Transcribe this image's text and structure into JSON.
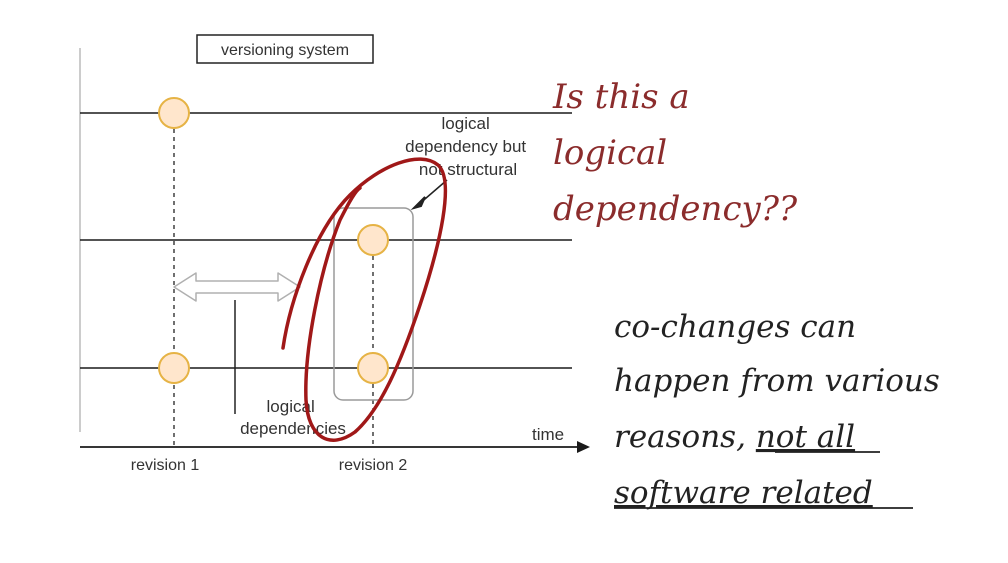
{
  "diagram": {
    "title": "versioning system",
    "time_label": "time",
    "revisions": [
      "revision 1",
      "revision 2"
    ],
    "logical_dependency_note": [
      "logical",
      "dependency but",
      "not structural"
    ],
    "logical_dependencies_label": [
      "logical",
      "dependencies"
    ]
  },
  "annotations": {
    "question": [
      "Is this a",
      "logical",
      "dependency??"
    ],
    "comment": [
      "co-changes can",
      "happen from various"
    ],
    "comment_line3_plain": "reasons, ",
    "comment_line3_underlined": "not all",
    "comment_line4_underlined": "software related"
  },
  "colors": {
    "lane_line": "#1a1a1a",
    "node_fill": "#ffe6cc",
    "node_stroke": "#e6b345",
    "circle_annotation": "#a01818",
    "question_text": "#8b2c2c",
    "comment_text": "#222222",
    "group_box": "#9a9a9a",
    "double_arrow": "#b0b0b0"
  }
}
